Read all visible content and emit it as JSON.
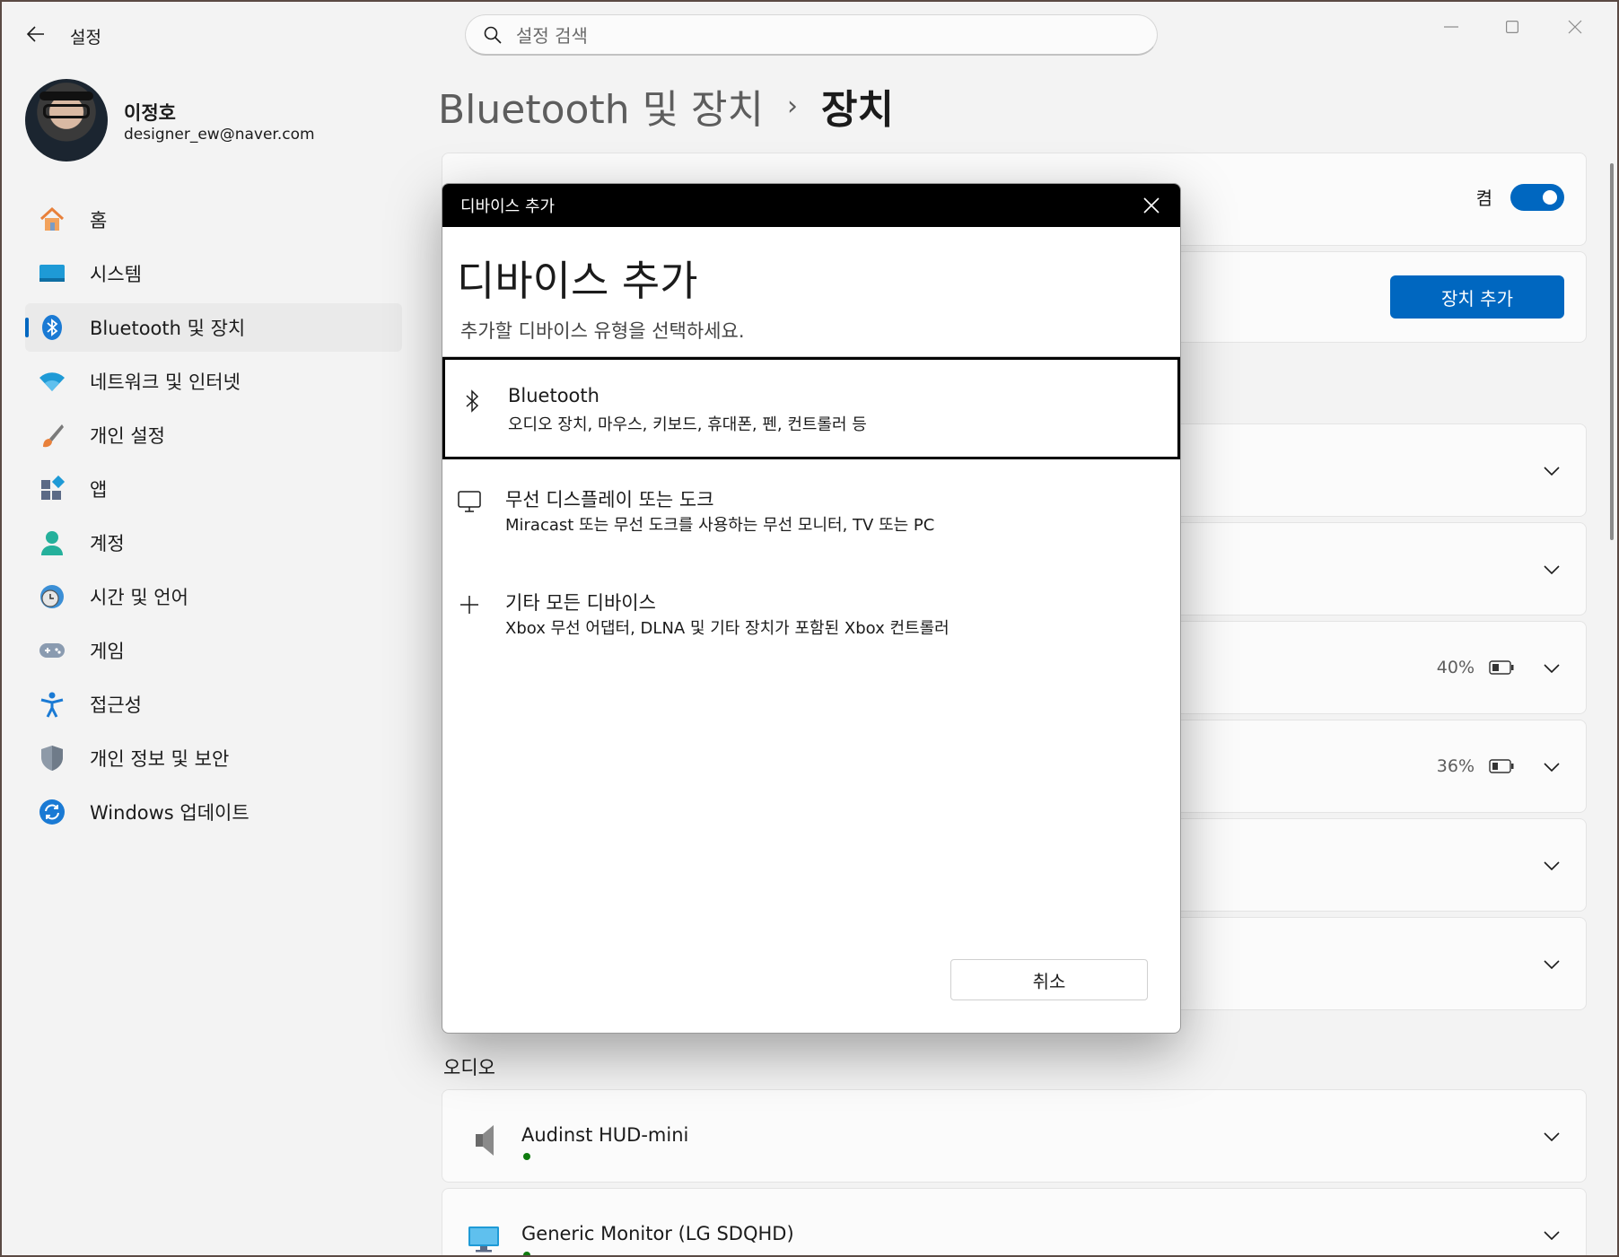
{
  "app": {
    "title": "설정",
    "back_icon": "back-arrow-icon"
  },
  "search": {
    "placeholder": "설정 검색"
  },
  "profile": {
    "name": "이정호",
    "email": "designer_ew@naver.com"
  },
  "nav": {
    "items": [
      {
        "label": "홈",
        "icon": "home-icon"
      },
      {
        "label": "시스템",
        "icon": "system-icon"
      },
      {
        "label": "Bluetooth 및 장치",
        "icon": "bluetooth-icon",
        "active": true
      },
      {
        "label": "네트워크 및 인터넷",
        "icon": "wifi-icon"
      },
      {
        "label": "개인 설정",
        "icon": "brush-icon"
      },
      {
        "label": "앱",
        "icon": "apps-icon"
      },
      {
        "label": "계정",
        "icon": "account-icon"
      },
      {
        "label": "시간 및 언어",
        "icon": "clock-globe-icon"
      },
      {
        "label": "게임",
        "icon": "gamepad-icon"
      },
      {
        "label": "접근성",
        "icon": "accessibility-icon"
      },
      {
        "label": "개인 정보 및 보안",
        "icon": "shield-icon"
      },
      {
        "label": "Windows 업데이트",
        "icon": "update-icon"
      }
    ]
  },
  "breadcrumb": {
    "parent": "Bluetooth 및 장치",
    "separator": "›",
    "current": "장치"
  },
  "bluetooth_card": {
    "toggle_label": "켬",
    "toggle_on": true
  },
  "add_card": {
    "button_label": "장치 추가"
  },
  "device_rows": [
    {
      "battery": ""
    },
    {
      "battery": ""
    },
    {
      "battery": "40%"
    },
    {
      "battery": "36%"
    },
    {
      "battery": ""
    },
    {
      "battery": ""
    }
  ],
  "audio": {
    "section_title": "오디오",
    "devices": [
      {
        "name": "Audinst HUD-mini",
        "icon": "speaker-icon",
        "connected": true
      },
      {
        "name": "Generic Monitor (LG SDQHD)",
        "icon": "monitor-icon",
        "connected": true
      }
    ]
  },
  "dialog": {
    "window_title": "디바이스 추가",
    "heading": "디바이스 추가",
    "subtitle": "추가할 디바이스 유형을 선택하세요.",
    "options": [
      {
        "title": "Bluetooth",
        "desc": "오디오 장치, 마우스, 키보드, 휴대폰, 펜, 컨트롤러 등",
        "icon": "bluetooth-icon",
        "selected": true
      },
      {
        "title": "무선 디스플레이 또는 도크",
        "desc": "Miracast 또는 무선 도크를 사용하는 무선 모니터, TV 또는 PC",
        "icon": "display-icon"
      },
      {
        "title": "기타 모든 디바이스",
        "desc": "Xbox 무선 어댑터, DLNA 및 기타 장치가 포함된 Xbox 컨트롤러",
        "icon": "plus-icon"
      }
    ],
    "cancel_label": "취소"
  },
  "colors": {
    "accent": "#0067c0",
    "background": "#f3f3f3",
    "card": "#fbfbfb",
    "status_green": "#0f7b0f"
  }
}
